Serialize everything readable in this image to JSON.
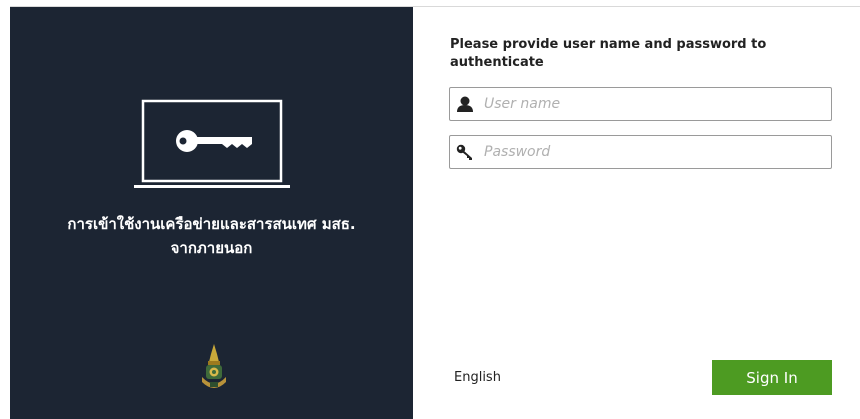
{
  "left_panel": {
    "headline_line1": "การเข้าใช้งานเครือข่ายและสารสนเทศ มสธ.",
    "headline_line2": "จากภายนอก",
    "illustration": "laptop-key-icon",
    "logo": "university-emblem",
    "background_color": "#1c2533"
  },
  "login_form": {
    "prompt": "Please provide user name and password to authenticate",
    "username": {
      "placeholder": "User name",
      "value": "",
      "icon": "user-icon"
    },
    "password": {
      "placeholder": "Password",
      "value": "",
      "icon": "key-icon"
    },
    "language_link": "English",
    "sign_in_label": "Sign In",
    "accent_color": "#4d9b22"
  }
}
